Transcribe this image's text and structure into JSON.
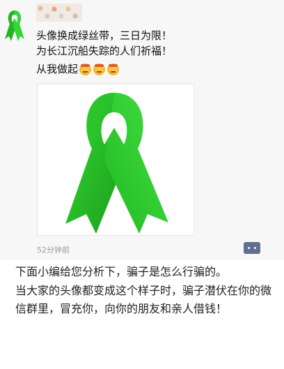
{
  "moment_post": {
    "author_name_blurred": true,
    "lines": [
      "头像换成绿丝带，三日为限！",
      "为长江沉船失踪的人们祈福！"
    ],
    "line3": "从我做起",
    "emoji_names": [
      "emoji-face",
      "emoji-face",
      "emoji-face"
    ],
    "timestamp": "52分钟前",
    "ribbon_color": "#2bc62b"
  },
  "article": {
    "paragraphs": [
      "下面小编给您分析下，骗子是怎么行骗的。",
      "当大家的头像都变成这个样子时，骗子潜伏在你的微信群里，冒充你，向你的朋友和亲人借钱！"
    ]
  }
}
